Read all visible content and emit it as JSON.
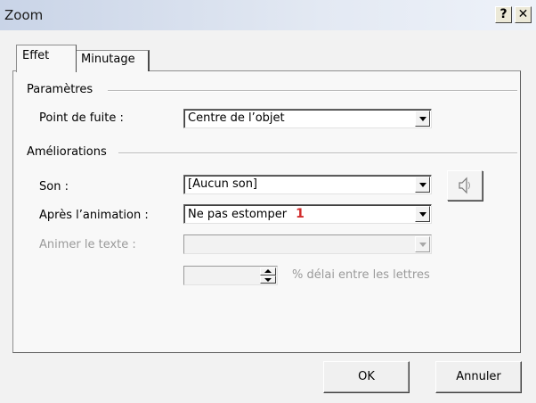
{
  "window": {
    "title": "Zoom",
    "help_label": "?",
    "close_label": "✕"
  },
  "tabs": [
    {
      "label": "Effet",
      "active": true
    },
    {
      "label": "Minutage",
      "active": false
    }
  ],
  "groups": {
    "parametres": "Paramètres",
    "ameliorations": "Améliorations"
  },
  "fields": {
    "point_de_fuite": {
      "label": "Point de fuite :",
      "value": "Centre de l’objet"
    },
    "son": {
      "label": "Son :",
      "value": "[Aucun son]",
      "icon": "speaker-icon"
    },
    "apres_animation": {
      "label": "Après l’animation :",
      "value": "Ne pas estomper",
      "marker": "1"
    },
    "animer_texte": {
      "label": "Animer le texte :",
      "value": ""
    },
    "delai": {
      "value": "",
      "suffix": "% délai entre les lettres"
    }
  },
  "buttons": {
    "ok": "OK",
    "cancel": "Annuler"
  },
  "colors": {
    "marker": "#d22d2d",
    "titlebar": "#c9d4e7",
    "disabled_text": "#9a9a9a"
  }
}
